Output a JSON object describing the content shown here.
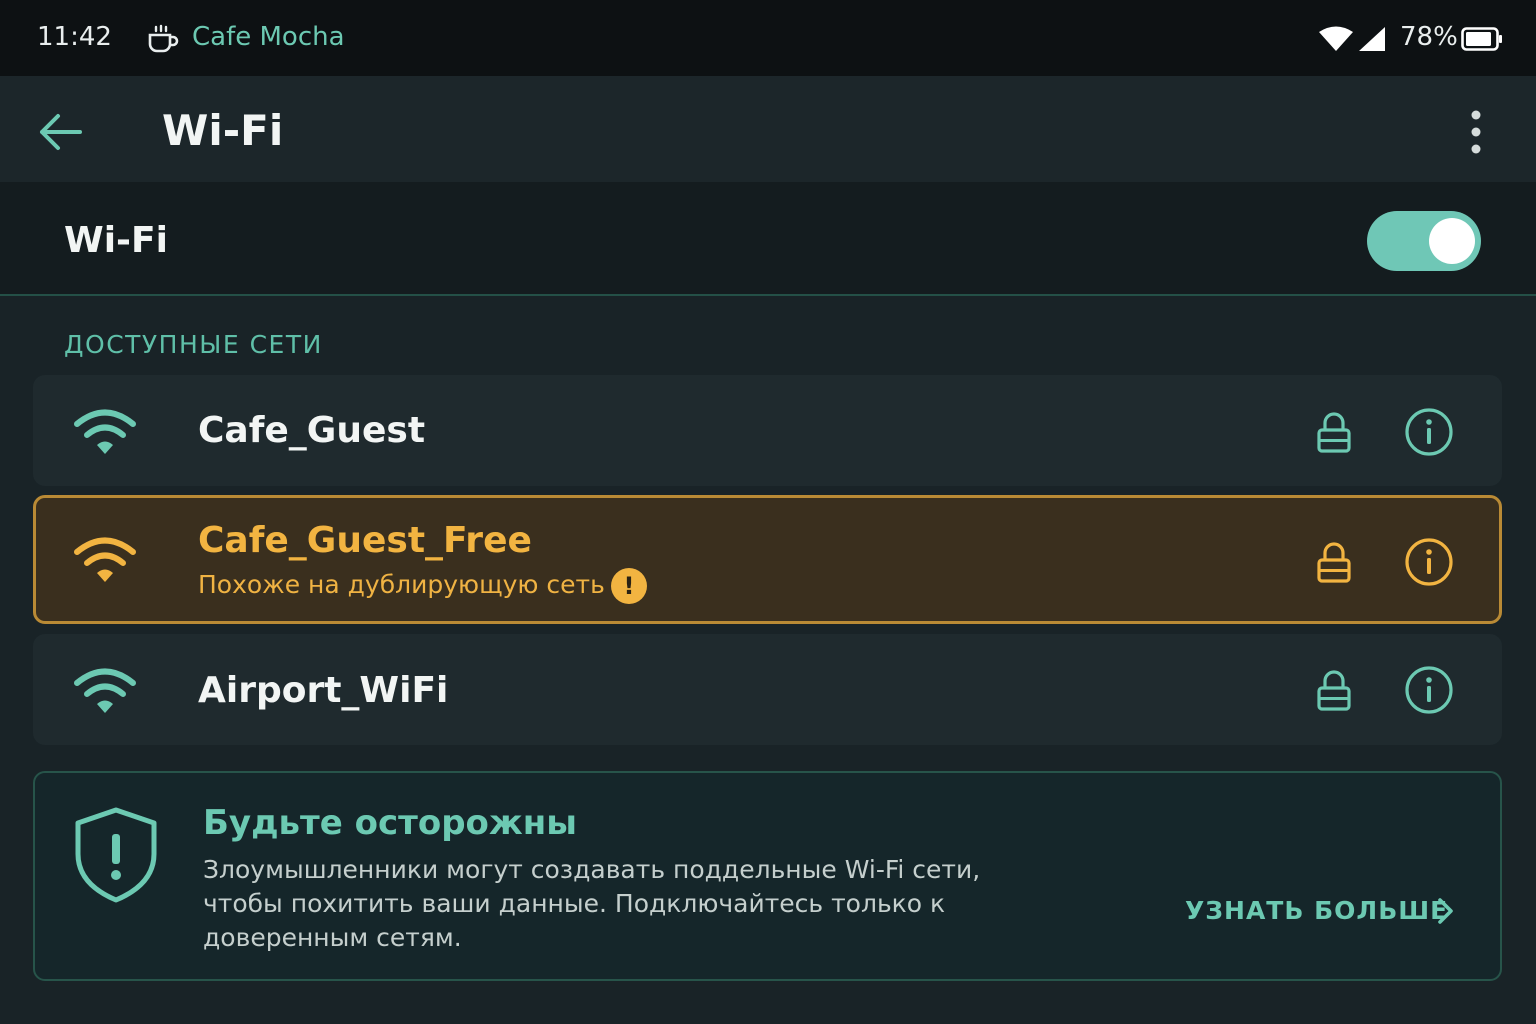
{
  "status_bar": {
    "time": "11:42",
    "app_icon": "coffee-cup-icon",
    "app_name": "Cafe Mocha",
    "battery": "78%",
    "icons": [
      "wifi-signal-icon",
      "cellular-signal-icon",
      "battery-icon"
    ]
  },
  "app_bar": {
    "title": "Wi-Fi",
    "back_icon": "arrow-left-icon",
    "menu_icon": "more-vertical-icon"
  },
  "wifi_toggle": {
    "label": "Wi-Fi",
    "enabled": true
  },
  "networks_section": {
    "header": "ДОСТУПНЫЕ СЕТИ",
    "networks": [
      {
        "name": "Cafe_Guest",
        "secured": true,
        "warning": ""
      },
      {
        "name": "Cafe_Guest_Free",
        "secured": true,
        "warning": "Похоже на дублирующую сеть"
      },
      {
        "name": "Airport_WiFi",
        "secured": true,
        "warning": ""
      }
    ]
  },
  "security_notice": {
    "icon": "shield-alert-icon",
    "title": "Будьте осторожны",
    "body": "Злоумышленники могут создавать поддельные Wi-Fi сети, чтобы похитить ваши данные. Подключайтесь только к доверенным сетям.",
    "action": "УЗНАТЬ БОЛЬШЕ"
  },
  "colors": {
    "accent": "#6cc9b2",
    "warning": "#f2b441",
    "background": "#192327",
    "card": "#1f2a2e"
  }
}
